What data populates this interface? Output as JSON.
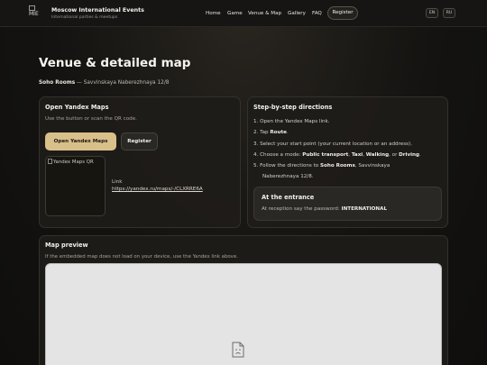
{
  "header": {
    "logo_alt": "MIE",
    "brand_title": "Moscow International Events",
    "brand_subtitle": "International parties & meetups",
    "nav": [
      "Home",
      "Game",
      "Venue & Map",
      "Gallery",
      "FAQ"
    ],
    "register_label": "Register",
    "languages": [
      "EN",
      "RU"
    ]
  },
  "page": {
    "title": "Venue & detailed map",
    "venue_name": "Soho Rooms",
    "venue_address": " — Savvinskaya Naberezhnaya 12/8"
  },
  "yandex_card": {
    "title": "Open Yandex Maps",
    "description": "Use the button or scan the QR code.",
    "open_button": "Open Yandex Maps",
    "register_button": "Register",
    "qr_alt": "Yandex Maps QR",
    "link_label": "Link",
    "link_url": "https://yandex.ru/maps/-/CLXRRE6A"
  },
  "directions_card": {
    "title": "Step-by-step directions",
    "steps": [
      {
        "pre": "1. Open the Yandex Maps link."
      },
      {
        "pre": "2. Tap ",
        "b1": "Route",
        "post": "."
      },
      {
        "pre": "3. Select your start point (your current location or an address)."
      },
      {
        "pre": "4. Choose a mode: ",
        "b1": "Public transport",
        "m1": ", ",
        "b2": "Taxi",
        "m2": ", ",
        "b3": "Walking",
        "m3": ", or ",
        "b4": "Driving",
        "post": "."
      },
      {
        "pre": "5. Follow the directions to ",
        "b1": "Soho Rooms",
        "post": ", Savvinskaya"
      },
      {
        "pre": "    Naberezhnaya 12/8."
      }
    ],
    "entrance_title": "At the entrance",
    "entrance_text": "At reception say the password: ",
    "entrance_password": "INTERNATIONAL"
  },
  "map_card": {
    "title": "Map preview",
    "note": "If the embedded map does not load on your device, use the Yandex link above.",
    "placeholder_icon": "broken-page-icon"
  }
}
